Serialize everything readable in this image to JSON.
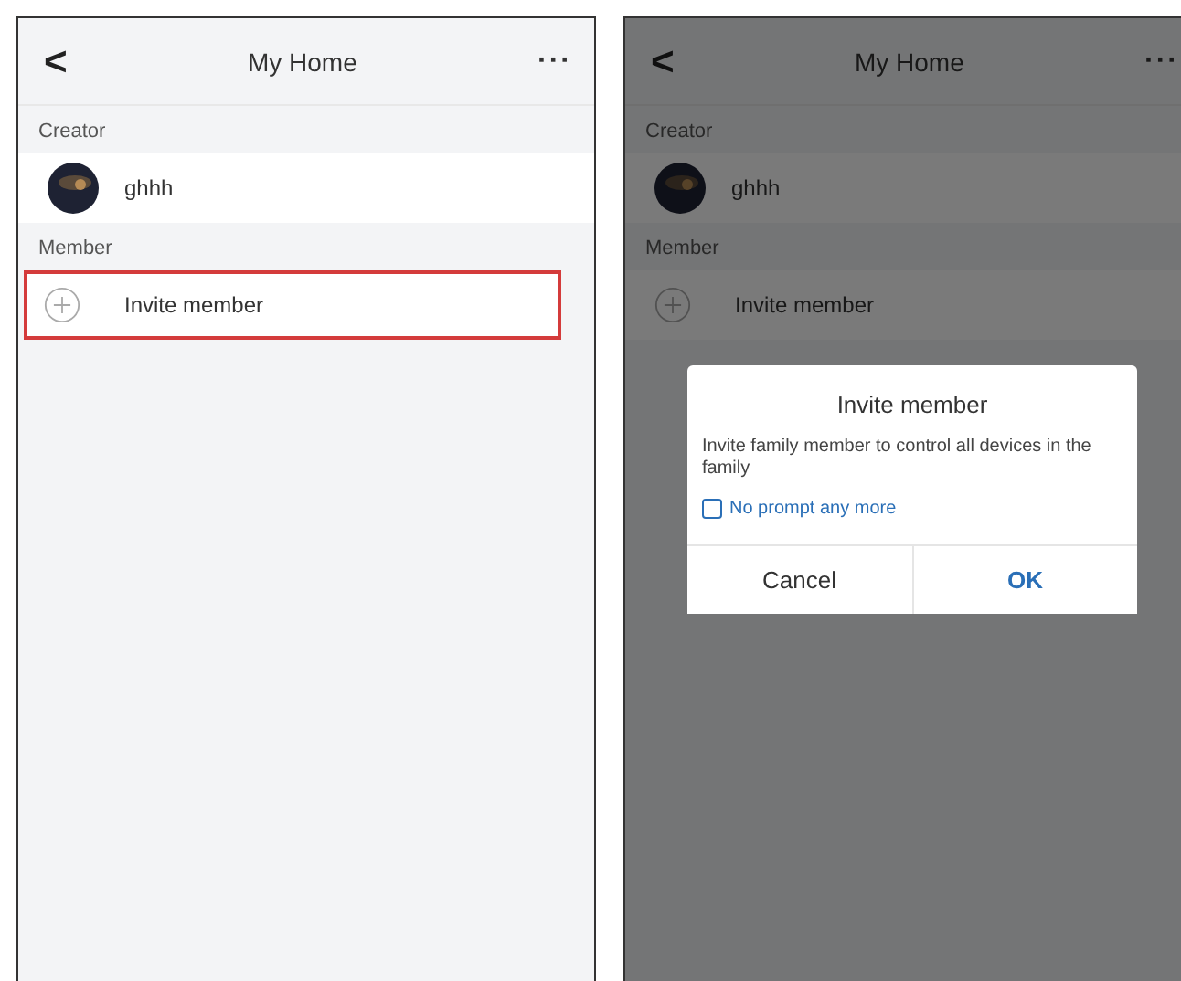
{
  "screens": [
    {
      "header": {
        "back": "<",
        "title": "My Home",
        "more": "···"
      },
      "dimmed": false,
      "sections": [
        {
          "label": "Creator",
          "rows": [
            {
              "kind": "user",
              "name": "ghhh",
              "highlighted": false
            }
          ]
        },
        {
          "label": "Member",
          "rows": [
            {
              "kind": "action",
              "name": "Invite member",
              "highlighted": true
            }
          ]
        }
      ]
    },
    {
      "header": {
        "back": "<",
        "title": "My Home",
        "more": "···"
      },
      "dimmed": true,
      "sections": [
        {
          "label": "Creator",
          "rows": [
            {
              "kind": "user",
              "name": "ghhh",
              "highlighted": false
            }
          ]
        },
        {
          "label": "Member",
          "rows": [
            {
              "kind": "action",
              "name": "Invite member",
              "highlighted": false
            }
          ]
        }
      ],
      "dialog": {
        "title": "Invite member",
        "message": "Invite family member to control all devices in the family",
        "checkbox": {
          "label": "No prompt any more",
          "checked": false
        },
        "buttons": [
          {
            "label": "Cancel",
            "kind": "cancel"
          },
          {
            "label": "OK",
            "kind": "primary"
          }
        ]
      }
    }
  ]
}
